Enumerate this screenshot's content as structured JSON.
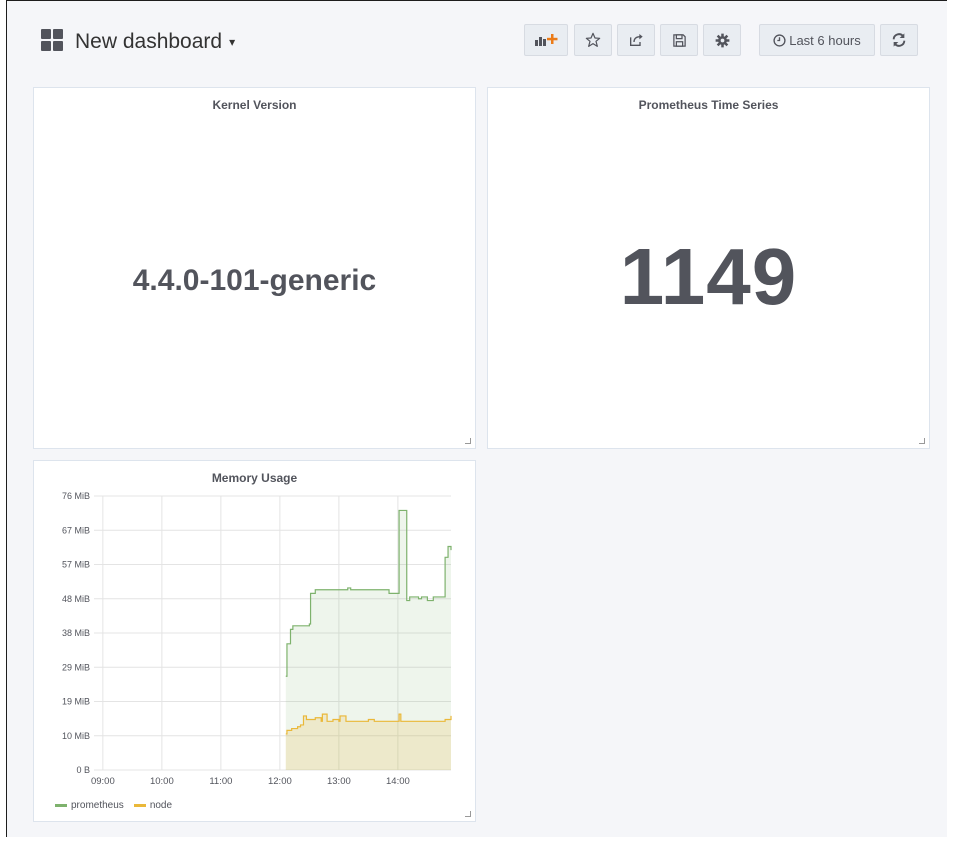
{
  "header": {
    "title": "New dashboard",
    "time_range_label": "Last 6 hours",
    "icons": [
      "add-panel-icon",
      "star-icon",
      "share-icon",
      "save-icon",
      "gear-icon",
      "clock-icon",
      "refresh-icon"
    ]
  },
  "panels": {
    "kernel": {
      "title": "Kernel Version",
      "value": "4.4.0-101-generic"
    },
    "prometheus": {
      "title": "Prometheus Time Series",
      "value": "1149"
    },
    "memory": {
      "title": "Memory Usage"
    }
  },
  "colors": {
    "prometheus": "#7eb26d",
    "node": "#eab839",
    "text": "#52545c",
    "background": "#f5f6f9",
    "panel": "#ffffff"
  },
  "chart_data": {
    "type": "area",
    "title": "Memory Usage",
    "xlabel": "",
    "ylabel": "",
    "x_ticks": [
      "09:00",
      "10:00",
      "11:00",
      "12:00",
      "13:00",
      "14:00"
    ],
    "y_ticks": [
      "0 B",
      "10 MiB",
      "19 MiB",
      "29 MiB",
      "38 MiB",
      "48 MiB",
      "57 MiB",
      "67 MiB",
      "76 MiB"
    ],
    "xlim": [
      8.85,
      14.9
    ],
    "ylim": [
      0,
      76
    ],
    "grid": true,
    "legend_position": "bottom-left",
    "series": [
      {
        "name": "prometheus",
        "color": "#7eb26d",
        "x": [
          12.1,
          12.12,
          12.18,
          12.22,
          12.3,
          12.32,
          12.35,
          12.45,
          12.5,
          12.52,
          12.6,
          12.8,
          13.0,
          13.1,
          13.15,
          13.2,
          13.5,
          13.7,
          13.75,
          13.85,
          13.9,
          14.0,
          14.02,
          14.12,
          14.15,
          14.2,
          14.35,
          14.4,
          14.45,
          14.5,
          14.6,
          14.7,
          14.75,
          14.8,
          14.85,
          14.9
        ],
        "y": [
          26,
          35,
          39,
          40,
          40,
          40,
          40,
          40,
          40.5,
          49,
          50,
          50,
          50,
          50,
          50.5,
          50,
          50,
          50,
          50,
          49,
          49,
          49,
          72,
          72,
          47,
          48,
          47.5,
          48,
          48,
          47,
          48,
          48,
          48,
          59,
          62,
          61
        ]
      },
      {
        "name": "node",
        "color": "#eab839",
        "x": [
          12.1,
          12.12,
          12.2,
          12.3,
          12.35,
          12.4,
          12.45,
          12.5,
          12.55,
          12.6,
          12.7,
          12.72,
          12.8,
          12.9,
          13.0,
          13.02,
          13.1,
          13.12,
          13.2,
          13.4,
          13.5,
          13.6,
          13.8,
          14.0,
          14.02,
          14.05,
          14.2,
          14.5,
          14.7,
          14.8,
          14.9
        ],
        "y": [
          10,
          11,
          11.5,
          12,
          12.5,
          15,
          14,
          14,
          14,
          14.5,
          13.5,
          15.5,
          13.5,
          14,
          13.5,
          15,
          15,
          13.5,
          13.5,
          13.5,
          14,
          13.5,
          13.5,
          13.5,
          15.5,
          13.5,
          13.5,
          13.5,
          13.5,
          14,
          15
        ]
      }
    ]
  }
}
